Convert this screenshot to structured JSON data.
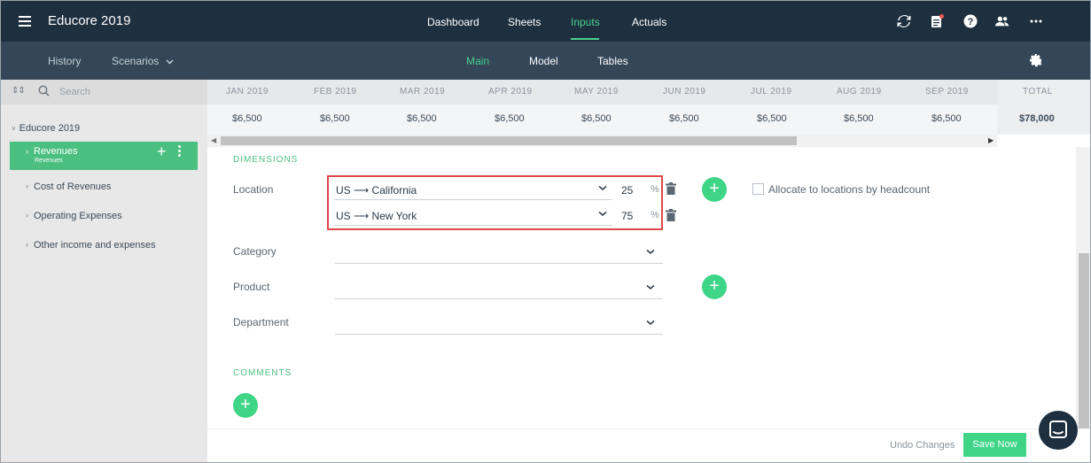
{
  "app": {
    "title": "Educore 2019"
  },
  "top_nav": {
    "items": [
      {
        "label": "Dashboard"
      },
      {
        "label": "Sheets"
      },
      {
        "label": "Inputs",
        "active": true
      },
      {
        "label": "Actuals"
      }
    ],
    "icons": [
      "sync-icon",
      "notifications-icon",
      "help-icon",
      "users-icon",
      "more-icon"
    ]
  },
  "sub_nav": {
    "history": "History",
    "scenarios": "Scenarios",
    "tabs": [
      {
        "label": "Main",
        "active": true
      },
      {
        "label": "Model"
      },
      {
        "label": "Tables"
      }
    ]
  },
  "sidebar": {
    "search_placeholder": "Search",
    "root": "Educore 2019",
    "items": [
      {
        "label": "Revenues",
        "sublabel": "Revenues",
        "active": true
      },
      {
        "label": "Cost of Revenues"
      },
      {
        "label": "Operating Expenses"
      },
      {
        "label": "Other income and expenses"
      }
    ]
  },
  "grid": {
    "months": [
      "JAN 2019",
      "FEB 2019",
      "MAR 2019",
      "APR 2019",
      "MAY 2019",
      "JUN 2019",
      "JUL 2019",
      "AUG 2019",
      "SEP 2019"
    ],
    "values": [
      "$6,500",
      "$6,500",
      "$6,500",
      "$6,500",
      "$6,500",
      "$6,500",
      "$6,500",
      "$6,500",
      "$6,500"
    ],
    "total_label": "TOTAL",
    "total_value": "$78,000"
  },
  "dimensions": {
    "title": "DIMENSIONS",
    "location_label": "Location",
    "locations": [
      {
        "value": "US ⟶ California",
        "percent": "25",
        "unit": "%"
      },
      {
        "value": "US ⟶ New York",
        "percent": "75",
        "unit": "%"
      }
    ],
    "allocate_label": "Allocate to locations by headcount",
    "category_label": "Category",
    "product_label": "Product",
    "department_label": "Department"
  },
  "comments": {
    "title": "COMMENTS"
  },
  "footer": {
    "undo": "Undo Changes",
    "save": "Save Now"
  },
  "colors": {
    "accent": "#3ed587",
    "topbar": "#1e2f3f",
    "subbar": "#344658",
    "highlight": "#e04848"
  }
}
